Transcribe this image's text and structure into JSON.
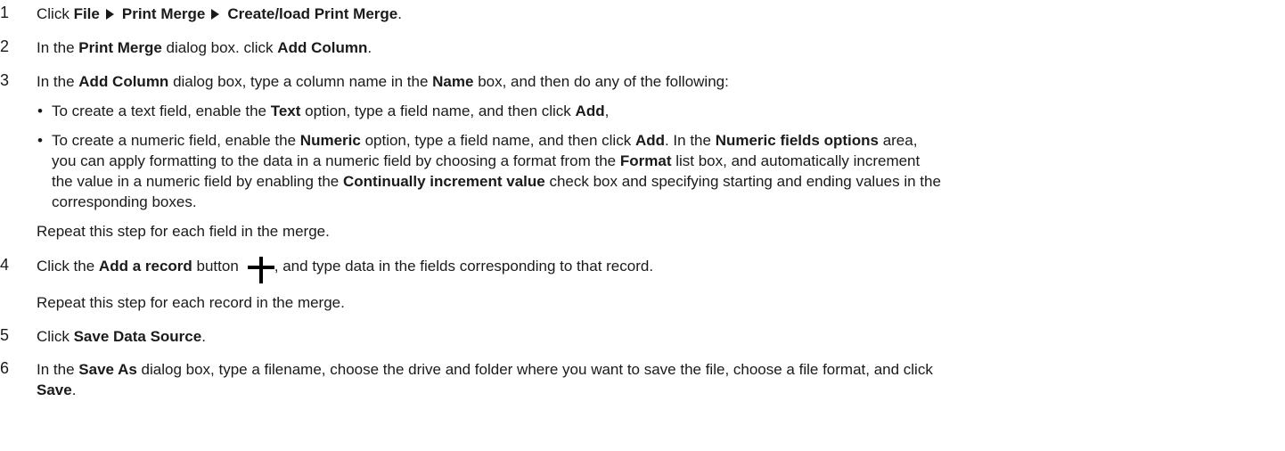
{
  "steps": [
    {
      "number": "1"
    },
    {
      "number": "2"
    },
    {
      "number": "3"
    },
    {
      "number": "4"
    },
    {
      "number": "5"
    },
    {
      "number": "6"
    }
  ],
  "s1": {
    "click": "Click",
    "file": "File",
    "print_merge": "Print Merge",
    "create_load": "Create/load Print Merge",
    "end": "."
  },
  "s2": {
    "in_the": "In the",
    "dialog": "Print Merge",
    "mid": "dialog box. click",
    "button": "Add Column",
    "end": "."
  },
  "s3": {
    "in_the": "In the",
    "dialog": "Add Column",
    "mid": "dialog box, type a column name in the",
    "name": "Name",
    "end": "box, and then do any of the following:",
    "bullet_a": {
      "t1": "To create a text field, enable the",
      "option": "Text",
      "t2": "option, type a field name, and then click",
      "add": "Add",
      "t3": ","
    },
    "bullet_b": {
      "t1": "To create a numeric field, enable the",
      "option": "Numeric",
      "t2": "option, type a field name, and then click",
      "add": "Add",
      "t3": ". In the",
      "area": "Numeric fields options",
      "t4": "area,",
      "l2a": "you can apply formatting to the data in a numeric field by choosing a format from the",
      "format": "Format",
      "l2b": "list box, and automatically increment",
      "l3a": "the value in a numeric field by enabling the",
      "check": "Continually increment value",
      "l3b": "check box and specifying starting and ending values in the",
      "l4": "corresponding boxes."
    },
    "repeat": "Repeat this step for each field in the merge."
  },
  "s4": {
    "click_the": "Click the",
    "button": "Add a record",
    "button_word": "button",
    "icon": "plus-icon",
    "rest": ", and type data in the fields corresponding to that record.",
    "repeat": "Repeat this step for each record in the merge."
  },
  "s5": {
    "click": "Click",
    "button": "Save Data Source",
    "end": "."
  },
  "s6": {
    "in_the": "In the",
    "dialog": "Save As",
    "rest": "dialog box, type a filename, choose the drive and folder where you want to save the file, choose a file format, and click",
    "save": "Save",
    "end": "."
  }
}
